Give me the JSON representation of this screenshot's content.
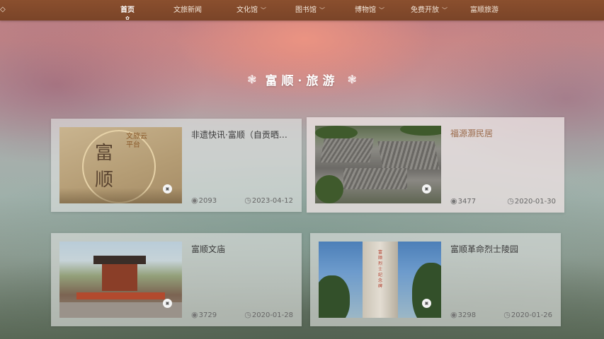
{
  "nav": {
    "items": [
      {
        "label": "首页",
        "active": true,
        "has_dropdown": false
      },
      {
        "label": "文旅新闻",
        "active": false,
        "has_dropdown": false
      },
      {
        "label": "文化馆",
        "active": false,
        "has_dropdown": true
      },
      {
        "label": "图书馆",
        "active": false,
        "has_dropdown": true
      },
      {
        "label": "博物馆",
        "active": false,
        "has_dropdown": true
      },
      {
        "label": "免费开放",
        "active": false,
        "has_dropdown": true
      },
      {
        "label": "富顺旅游",
        "active": false,
        "has_dropdown": false
      }
    ]
  },
  "section": {
    "title": "富顺·旅游",
    "ornament_icon": "flower-ornament-icon"
  },
  "cards": [
    {
      "title": "非遗快讯·富顺（自贡晒…",
      "views": "2093",
      "date": "2023-04-12",
      "thumb_text_big": "富顺",
      "thumb_text_side": "文旅云平台"
    },
    {
      "title": "福源灏民居",
      "views": "3477",
      "date": "2020-01-30"
    },
    {
      "title": "富顺文庙",
      "views": "3729",
      "date": "2020-01-28"
    },
    {
      "title": "富顺革命烈士陵园",
      "views": "3298",
      "date": "2020-01-26",
      "thumb_text": "富顺烈士纪念碑"
    }
  ],
  "icons": {
    "views": "eye-icon",
    "date": "clock-icon",
    "badge": "image-badge-icon",
    "dropdown": "chevron-down-icon"
  },
  "colors": {
    "nav_bg": "#7a4428",
    "title_text": "#ffffff",
    "card_highlight_title": "#9a6a4a"
  }
}
